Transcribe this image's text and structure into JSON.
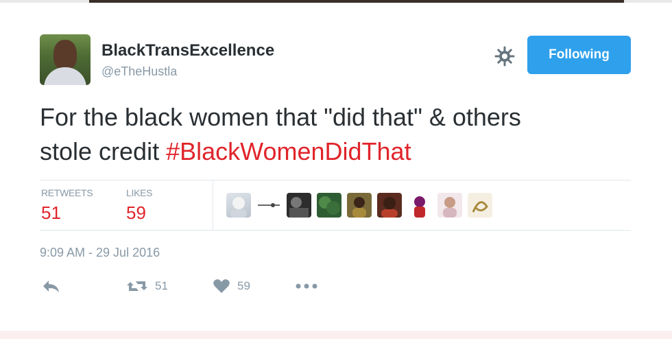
{
  "tweet": {
    "display_name": "BlackTransExcellence",
    "handle": "@eTheHustla",
    "follow_label": "Following",
    "text_plain": "For the black women that \"did that\" & others stole credit ",
    "text_line1": "For the black women that \"did that\" & others",
    "text_line2_plain": "stole credit ",
    "hashtag": "#BlackWomenDidThat",
    "timestamp": "9:09 AM - 29 Jul 2016"
  },
  "stats": {
    "retweets_label": "RETWEETS",
    "retweets_count": "51",
    "likes_label": "LIKES",
    "likes_count": "59"
  },
  "actions": {
    "retweet_count": "51",
    "like_count": "59"
  },
  "colors": {
    "accent_red": "#e0242a",
    "follow_blue": "#2ea0ec",
    "muted": "#8899a6"
  },
  "likers": [
    {
      "name": "liker-avatar-1"
    },
    {
      "name": "liker-avatar-2"
    },
    {
      "name": "liker-avatar-3"
    },
    {
      "name": "liker-avatar-4"
    },
    {
      "name": "liker-avatar-5"
    },
    {
      "name": "liker-avatar-6"
    },
    {
      "name": "liker-avatar-7"
    },
    {
      "name": "liker-avatar-8"
    },
    {
      "name": "liker-avatar-9"
    }
  ]
}
